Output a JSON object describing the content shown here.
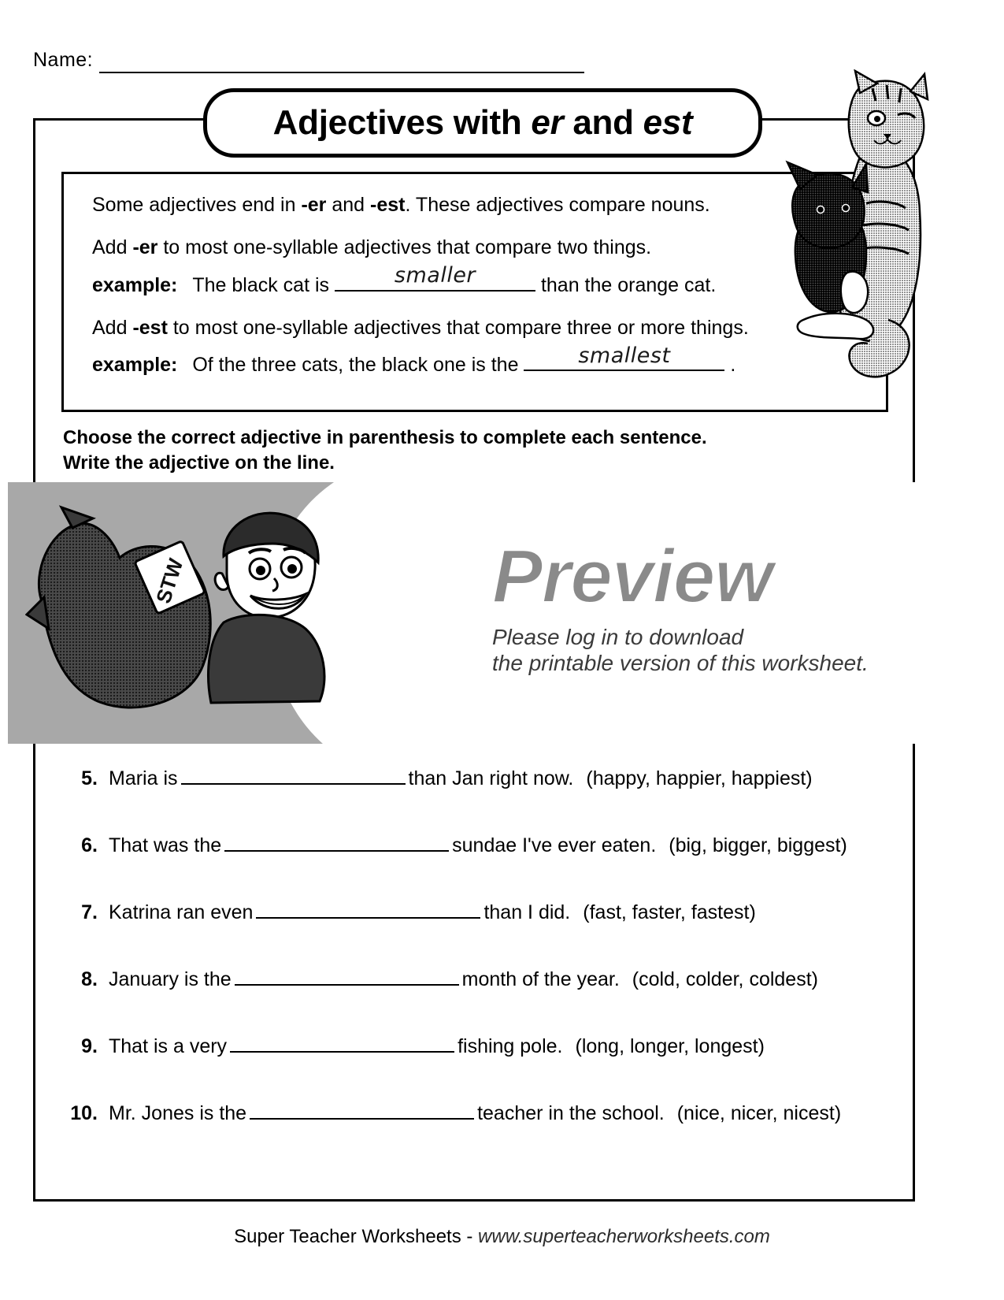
{
  "header": {
    "name_label": "Name:"
  },
  "title": {
    "prefix": "Adjectives with ",
    "em1": "er",
    "middle": " and ",
    "em2": "est",
    "full": "Adjectives with er and est"
  },
  "info_box": {
    "line1_a": "Some adjectives end in ",
    "line1_b": "-er",
    "line1_c": " and ",
    "line1_d": "-est",
    "line1_e": ". These adjectives compare nouns.",
    "line2_a": "Add ",
    "line2_b": "-er",
    "line2_c": " to most one-syllable adjectives that compare two things.",
    "example1_label": "example:",
    "example1_before": "The black cat is",
    "example1_answer": "smaller",
    "example1_after": "than the orange cat.",
    "line3_a": "Add ",
    "line3_b": "-est",
    "line3_c": " to most one-syllable adjectives that compare three or more things.",
    "example2_label": "example:",
    "example2_before": "Of the three cats, the black one is the",
    "example2_answer": "smallest",
    "example2_after": "."
  },
  "directions": {
    "line1": "Choose the correct adjective in parenthesis to complete each sentence.",
    "line2": "Write the adjective on the line."
  },
  "preview": {
    "word": "Preview",
    "sub_line1": "Please log in to download",
    "sub_line2": "the printable version of this worksheet.",
    "cape_text": "STW",
    "gray_hex": "#a8a8a8",
    "word_color_hex": "#8a8a8a"
  },
  "questions": [
    {
      "number": "5.",
      "before": "Maria is",
      "after": "than Jan right now.",
      "choices": "(happy, happier, happiest)",
      "blank_width": 285
    },
    {
      "number": "6.",
      "before": "That was the",
      "after": "sundae I've ever eaten.",
      "choices": "(big, bigger, biggest)",
      "blank_width": 285
    },
    {
      "number": "7.",
      "before": "Katrina ran even",
      "after": "than I did.",
      "choices": "(fast, faster, fastest)",
      "blank_width": 285
    },
    {
      "number": "8.",
      "before": "January is the",
      "after": "month of the year.",
      "choices": "(cold, colder, coldest)",
      "blank_width": 285
    },
    {
      "number": "9.",
      "before": "That is a very",
      "after": "fishing pole.",
      "choices": "(long, longer, longest)",
      "blank_width": 285
    },
    {
      "number": "10.",
      "before": "Mr. Jones is the",
      "after": "teacher in the school.",
      "choices": "(nice, nicer, nicest)",
      "blank_width": 285
    }
  ],
  "footer": {
    "brand": "Super Teacher Worksheets - ",
    "site": "www.superteacherworksheets.com"
  }
}
